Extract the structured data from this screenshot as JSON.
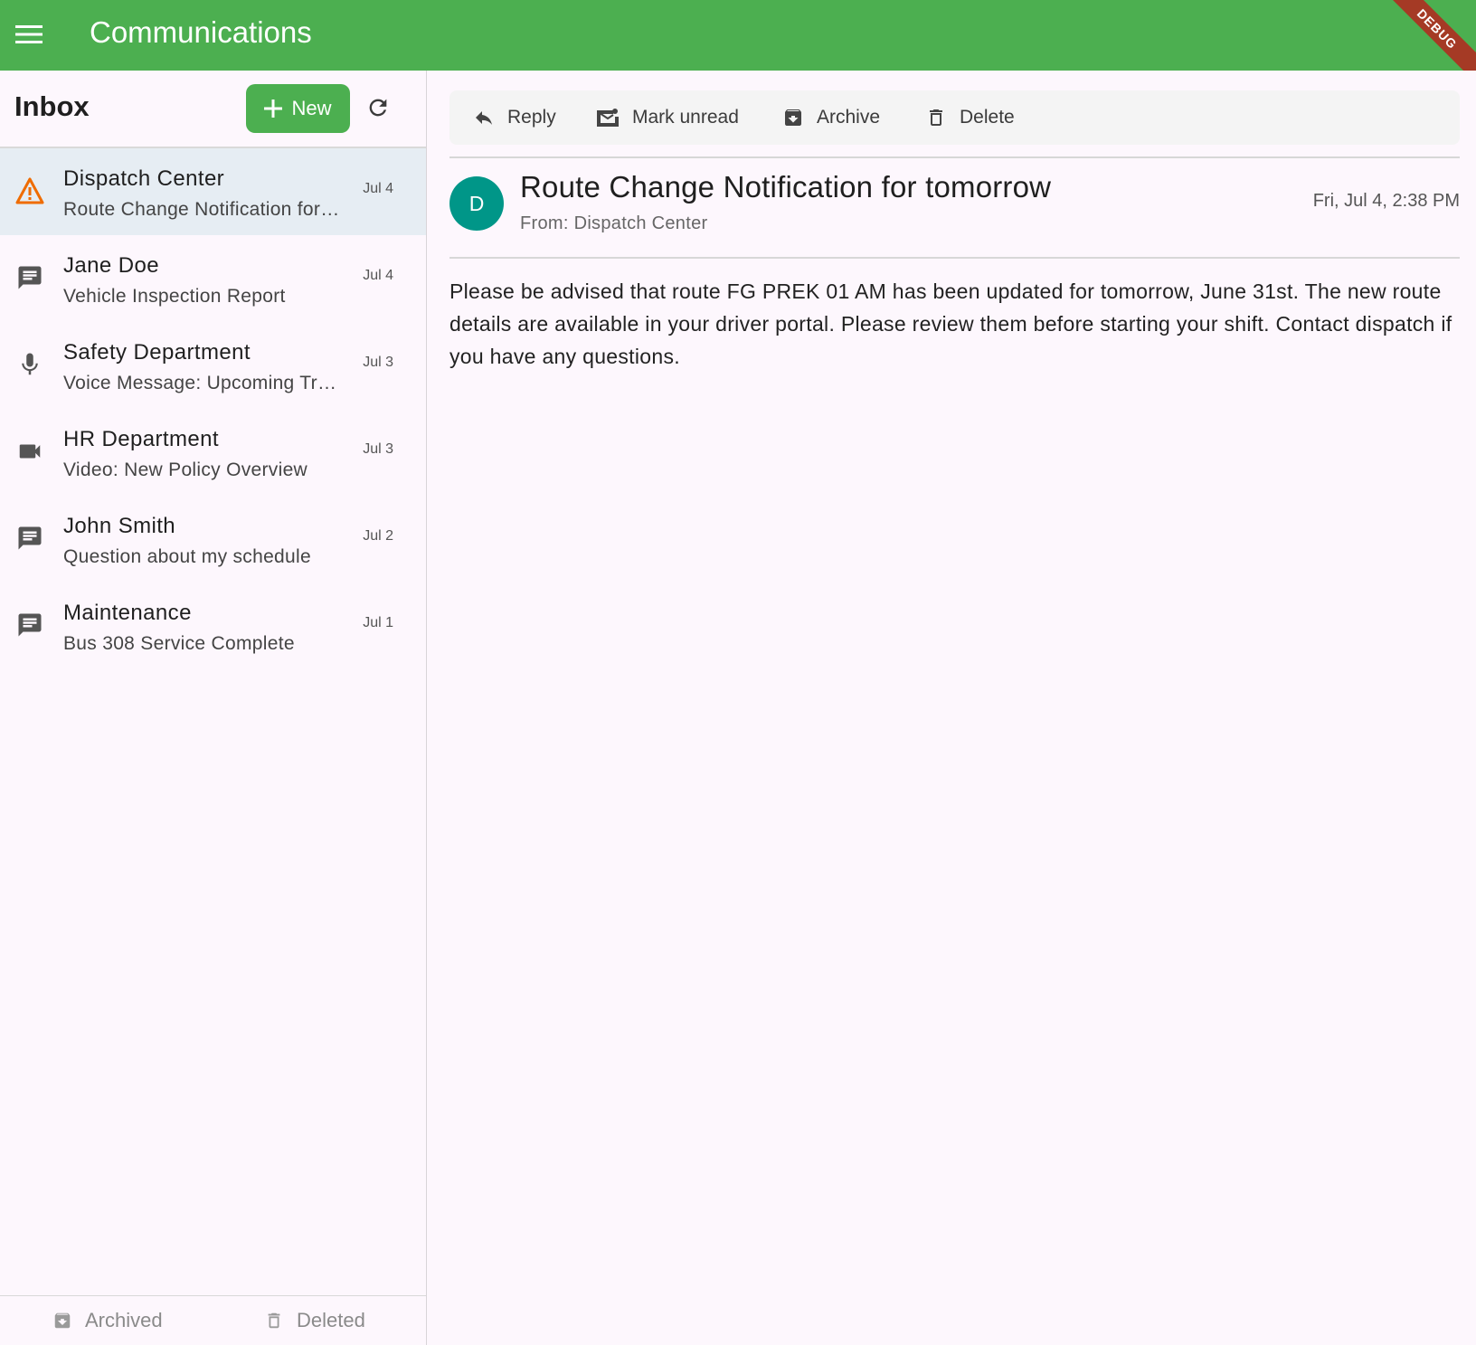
{
  "appbar": {
    "title": "Communications",
    "menu_icon": "menu-icon",
    "debug_label": "DEBUG",
    "color": "#4caf50"
  },
  "inbox": {
    "title": "Inbox",
    "new_button": "New",
    "messages": [
      {
        "sender": "Dispatch Center",
        "subject": "Route Change Notification for tomorrow",
        "date": "Jul 4",
        "icon": "warning-icon",
        "selected": true
      },
      {
        "sender": "Jane Doe",
        "subject": "Vehicle Inspection Report",
        "date": "Jul 4",
        "icon": "message-icon"
      },
      {
        "sender": "Safety Department",
        "subject": "Voice Message: Upcoming Training",
        "date": "Jul 3",
        "icon": "microphone-icon"
      },
      {
        "sender": "HR Department",
        "subject": "Video: New Policy Overview",
        "date": "Jul 3",
        "icon": "video-icon"
      },
      {
        "sender": "John Smith",
        "subject": "Question about my schedule",
        "date": "Jul 2",
        "icon": "message-icon"
      },
      {
        "sender": "Maintenance",
        "subject": "Bus 308 Service Complete",
        "date": "Jul 1",
        "icon": "message-icon"
      }
    ],
    "footer": {
      "archived": "Archived",
      "deleted": "Deleted"
    }
  },
  "toolbar": {
    "reply": "Reply",
    "mark_unread": "Mark unread",
    "archive": "Archive",
    "delete": "Delete"
  },
  "message": {
    "avatar_letter": "D",
    "avatar_color": "#009688",
    "title": "Route Change Notification for tomorrow",
    "from": "From: Dispatch Center",
    "datetime": "Fri, Jul 4, 2:38 PM",
    "body": "Please be advised that route FG PREK 01 AM has been updated for tomorrow, June 31st. The new route details are available in your driver portal. Please review them before starting your shift. Contact dispatch if you have any questions."
  }
}
